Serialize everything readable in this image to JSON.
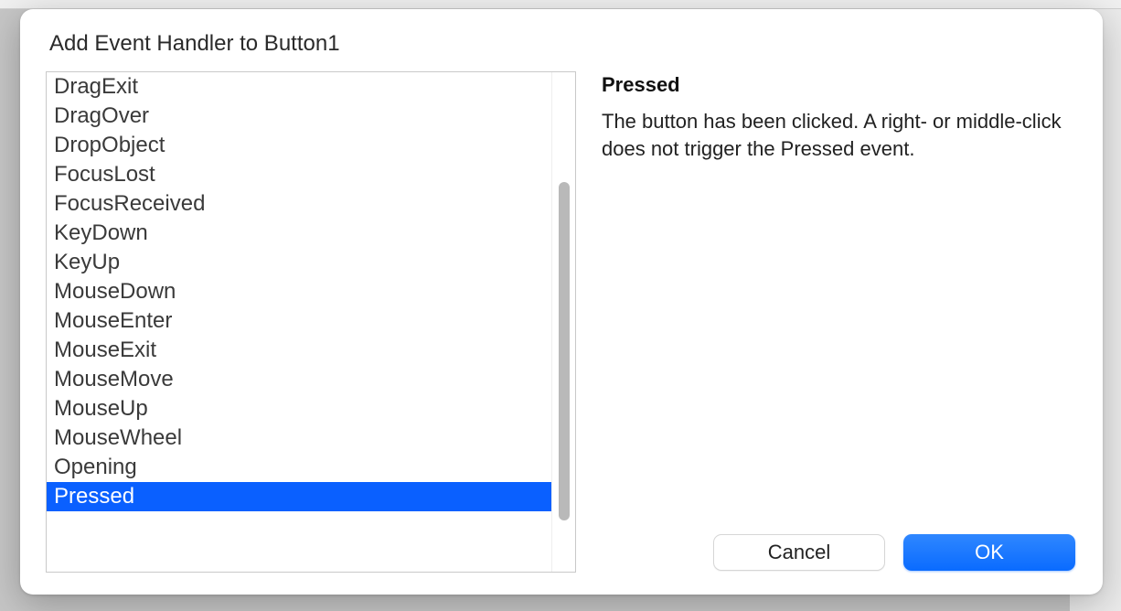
{
  "dialog": {
    "title": "Add Event Handler to Button1"
  },
  "events": {
    "items": [
      "DragExit",
      "DragOver",
      "DropObject",
      "FocusLost",
      "FocusReceived",
      "KeyDown",
      "KeyUp",
      "MouseDown",
      "MouseEnter",
      "MouseExit",
      "MouseMove",
      "MouseUp",
      "MouseWheel",
      "Opening",
      "Pressed"
    ],
    "selected_index": 14
  },
  "detail": {
    "title": "Pressed",
    "description": "The button has been clicked. A right- or middle-click does not trigger the Pressed event."
  },
  "buttons": {
    "cancel": "Cancel",
    "ok": "OK"
  },
  "colors": {
    "selection": "#0a60ff",
    "primary_button": "#0a6bff"
  }
}
